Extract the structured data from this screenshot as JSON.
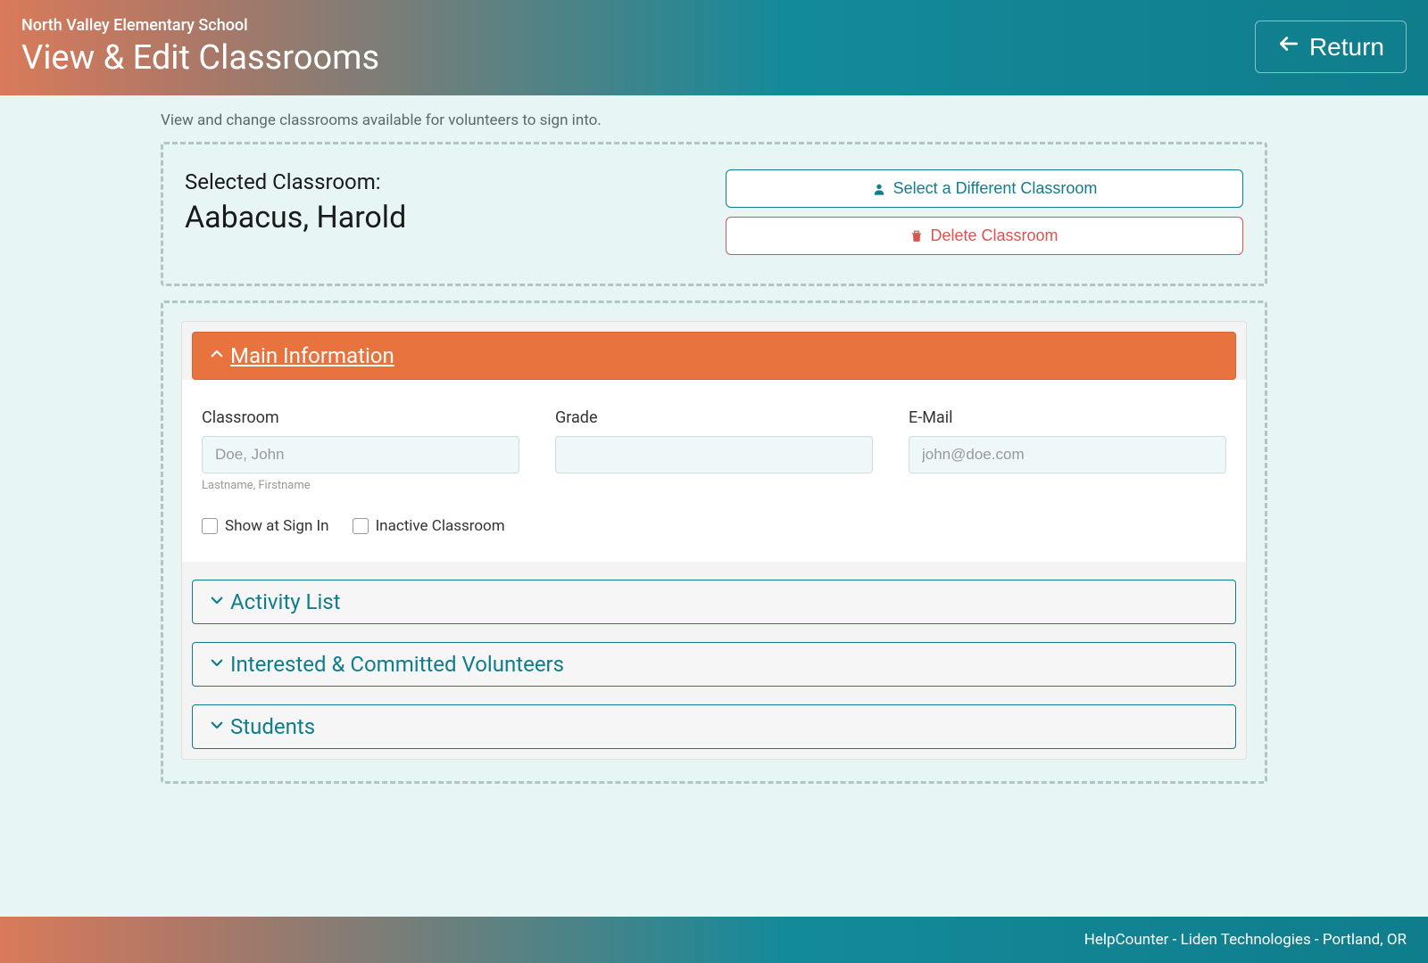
{
  "header": {
    "school_name": "North Valley Elementary School",
    "page_title": "View & Edit Classrooms",
    "return_label": "Return"
  },
  "description": "View and change classrooms available for volunteers to sign into.",
  "selected": {
    "label": "Selected Classroom:",
    "name": "Aabacus, Harold",
    "select_different": "Select a Different Classroom",
    "delete": "Delete Classroom"
  },
  "accordion": {
    "main_info": " Main Information",
    "activity_list": "Activity List",
    "interested": "Interested & Committed Volunteers",
    "students": "Students"
  },
  "form": {
    "classroom_label": "Classroom",
    "classroom_placeholder": "Doe, John",
    "classroom_helper": "Lastname, Firstname",
    "grade_label": "Grade",
    "email_label": "E-Mail",
    "email_placeholder": "john@doe.com",
    "show_at_signin": "Show at Sign In",
    "inactive": "Inactive Classroom"
  },
  "footer": "HelpCounter - Liden Technologies - Portland, OR"
}
